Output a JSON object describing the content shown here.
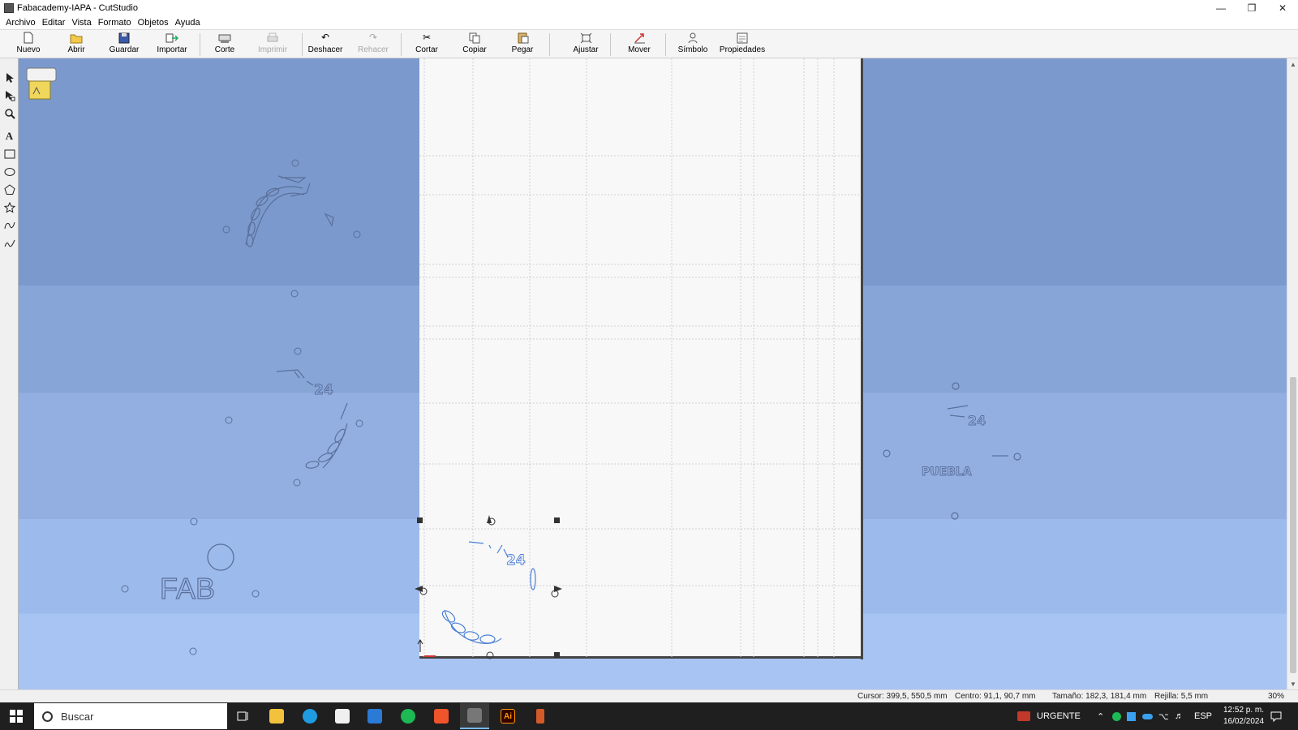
{
  "window": {
    "title": "Fabacademy-IAPA - CutStudio",
    "minimize_icon": "minimize-icon",
    "restore_icon": "restore-icon",
    "close_icon": "close-icon"
  },
  "menu": [
    "Archivo",
    "Editar",
    "Vista",
    "Formato",
    "Objetos",
    "Ayuda"
  ],
  "toolbar": {
    "nuevo": "Nuevo",
    "abrir": "Abrir",
    "guardar": "Guardar",
    "importar": "Importar",
    "corte": "Corte",
    "imprimir": "Imprimir",
    "deshacer": "Deshacer",
    "rehacer": "Rehacer",
    "cortar": "Cortar",
    "copiar": "Copiar",
    "pegar": "Pegar",
    "ajustar": "Ajustar",
    "mover": "Mover",
    "simbolo": "Símbolo",
    "propiedades": "Propiedades"
  },
  "left_tools": [
    "pointer-icon",
    "node-edit-icon",
    "zoom-icon",
    "text-icon",
    "rectangle-icon",
    "ellipse-icon",
    "polygon-icon",
    "star-icon",
    "bezier-icon",
    "freehand-icon"
  ],
  "canvas": {
    "text_fab": "FAB",
    "text_puebla": "PUEBLA",
    "text_24": "24",
    "colors": {
      "canvas_top": "#7b99cc",
      "canvas_bottom": "#a8c4f3",
      "sheet": "#f8f8f8",
      "selected_outline": "#4a7fd6",
      "ghost_outline": "#5a6f9a"
    }
  },
  "status": {
    "cursor": "Cursor: 399,5, 550,5 mm",
    "centro": "Centro: 91,1, 90,7 mm",
    "tamano": "Tamaño: 182,3, 181,4 mm",
    "rejilla": "Rejilla: 5,5 mm",
    "zoom": "30%"
  },
  "taskbar": {
    "search_placeholder": "Buscar",
    "news": "URGENTE",
    "language": "ESP",
    "time": "12:52 p. m.",
    "date": "16/02/2024"
  }
}
